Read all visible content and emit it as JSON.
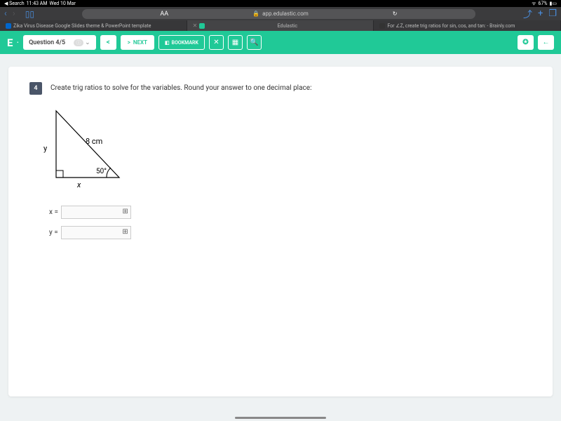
{
  "ios": {
    "back_app": "◀ Search",
    "time": "11:43 AM",
    "date": "Wed 10 Mar",
    "battery": "67%"
  },
  "safari": {
    "text_size": "AA",
    "lock": "🔒",
    "url": "app.edulastic.com",
    "refresh": "↻",
    "share": "⤴",
    "plus": "+",
    "tabs_icon": "❐"
  },
  "tabs": {
    "t1": "Zika Virus Disease Google Slides theme & PowerPoint template",
    "t2": "Edulastic",
    "t3": "For ∠Z, create trig ratios for sin, cos, and tan: - Brainly.com"
  },
  "app": {
    "logo": "E",
    "dot": "·",
    "question_label": "Question 4/5",
    "info": "ⓘ",
    "chevdown": "⌄",
    "prev": "<",
    "next_arrow": ">",
    "next": "NEXT",
    "bookmark_icon": "🔖",
    "bookmark": "BOOKMARK",
    "close": "✕",
    "calc": "▦",
    "zoom": "🔍",
    "accessibility": "✪",
    "back": "←"
  },
  "question": {
    "number": "4",
    "text": "Create trig ratios to solve for the variables. Round your answer to one decimal place:"
  },
  "triangle": {
    "hypotenuse": "8 cm",
    "angle": "50°",
    "side_y": "y",
    "side_x": "x"
  },
  "inputs": {
    "x_label": "x =",
    "y_label": "y =",
    "x_value": "",
    "y_value": ""
  },
  "nav": {
    "left": "‹",
    "right": "›"
  }
}
